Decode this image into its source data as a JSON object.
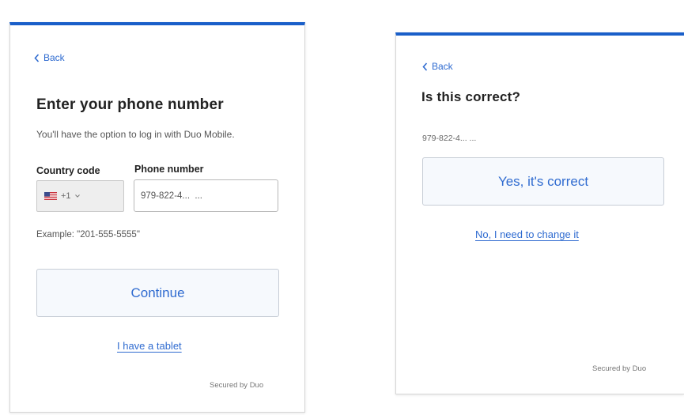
{
  "colors": {
    "accent": "#1a5fc9",
    "link": "#2f6bd0",
    "button_bg": "#f6f9fd"
  },
  "left_screen": {
    "back_label": "Back",
    "title": "Enter your phone number",
    "subtitle": "You'll have the option to log in with Duo Mobile.",
    "country_code_label": "Country code",
    "country_code_value": "+1",
    "country_flag_icon": "us-flag-icon",
    "phone_number_label": "Phone number",
    "phone_number_value": "979-822-4...  ...",
    "example_text": "Example: \"201-555-5555\"",
    "continue_label": "Continue",
    "tablet_link": "I have a tablet",
    "footer": "Secured by Duo"
  },
  "right_screen": {
    "back_label": "Back",
    "title": "Is this correct?",
    "number": "979-822-4...  ...",
    "confirm_label": "Yes, it's correct",
    "change_link": "No, I need to change it",
    "footer": "Secured by Duo"
  }
}
